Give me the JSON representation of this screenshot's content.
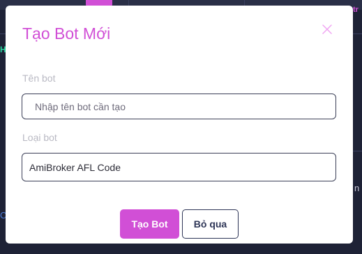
{
  "modal": {
    "title": "Tạo Bot Mới",
    "close_icon": "close-icon",
    "bot_name": {
      "label": "Tên bot",
      "placeholder": "Nhập tên bot cần tạo",
      "value": ""
    },
    "bot_type": {
      "label": "Loại bot",
      "selected": "AmiBroker AFL Code"
    },
    "buttons": {
      "create": "Tạo Bot",
      "skip": "Bỏ qua"
    }
  },
  "background": {
    "right_snippet": "tr",
    "left_snippet": "H",
    "right_mid_snippet": "n",
    "left_low_snippet": "C"
  },
  "colors": {
    "accent": "#d14fd6",
    "backdrop": "#1e2236",
    "border": "#3b3f57",
    "label": "#b9b9c3",
    "secondary_text": "#2d3556"
  }
}
